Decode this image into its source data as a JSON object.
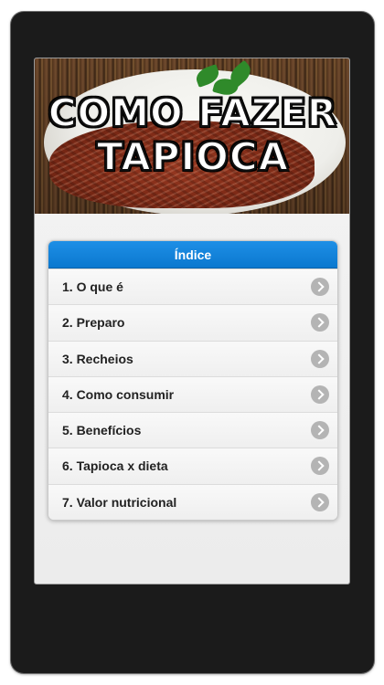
{
  "banner": {
    "title_line1": "COMO FAZER",
    "title_line2": "TAPIOCA"
  },
  "index": {
    "header": "Índice",
    "items": [
      {
        "label": "1. O que é",
        "icon": "chevron-right-icon"
      },
      {
        "label": "2. Preparo",
        "icon": "chevron-right-icon"
      },
      {
        "label": "3. Recheios",
        "icon": "chevron-right-icon"
      },
      {
        "label": "4. Como consumir",
        "icon": "chevron-right-icon"
      },
      {
        "label": "5. Benefícios",
        "icon": "chevron-right-icon"
      },
      {
        "label": "6. Tapioca x dieta",
        "icon": "chevron-right-icon"
      },
      {
        "label": "7. Valor nutricional",
        "icon": "chevron-right-icon"
      }
    ]
  },
  "colors": {
    "header_bg": "#0b78cf",
    "phone_frame": "#1b1b1b",
    "chevron_bg": "#b4b4b4"
  }
}
